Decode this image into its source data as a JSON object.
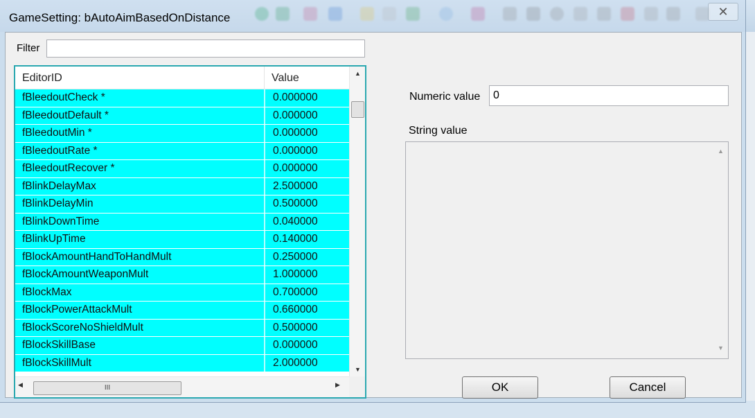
{
  "window": {
    "title": "GameSetting: bAutoAimBasedOnDistance",
    "close_glyph": "✕"
  },
  "filter": {
    "label": "Filter",
    "value": ""
  },
  "list": {
    "columns": [
      "EditorID",
      "Value"
    ],
    "rows": [
      {
        "id": "fBleedoutCheck *",
        "value": "0.000000"
      },
      {
        "id": "fBleedoutDefault *",
        "value": "0.000000"
      },
      {
        "id": "fBleedoutMin *",
        "value": "0.000000"
      },
      {
        "id": "fBleedoutRate *",
        "value": "0.000000"
      },
      {
        "id": "fBleedoutRecover *",
        "value": "0.000000"
      },
      {
        "id": "fBlinkDelayMax",
        "value": "2.500000"
      },
      {
        "id": "fBlinkDelayMin",
        "value": "0.500000"
      },
      {
        "id": "fBlinkDownTime",
        "value": "0.040000"
      },
      {
        "id": "fBlinkUpTime",
        "value": "0.140000"
      },
      {
        "id": "fBlockAmountHandToHandMult",
        "value": "0.250000"
      },
      {
        "id": "fBlockAmountWeaponMult",
        "value": "1.000000"
      },
      {
        "id": "fBlockMax",
        "value": "0.700000"
      },
      {
        "id": "fBlockPowerAttackMult",
        "value": "0.660000"
      },
      {
        "id": "fBlockScoreNoShieldMult",
        "value": "0.500000"
      },
      {
        "id": "fBlockSkillBase",
        "value": "0.000000"
      },
      {
        "id": "fBlockSkillMult",
        "value": "2.000000"
      }
    ],
    "hscroll_thumb_glyph": "III",
    "colors": {
      "row_highlight": "#00ffff",
      "border": "#2aa8b0"
    }
  },
  "numeric": {
    "label": "Numeric value",
    "value": "0"
  },
  "string": {
    "label": "String value",
    "value": ""
  },
  "buttons": {
    "ok": "OK",
    "cancel": "Cancel"
  }
}
